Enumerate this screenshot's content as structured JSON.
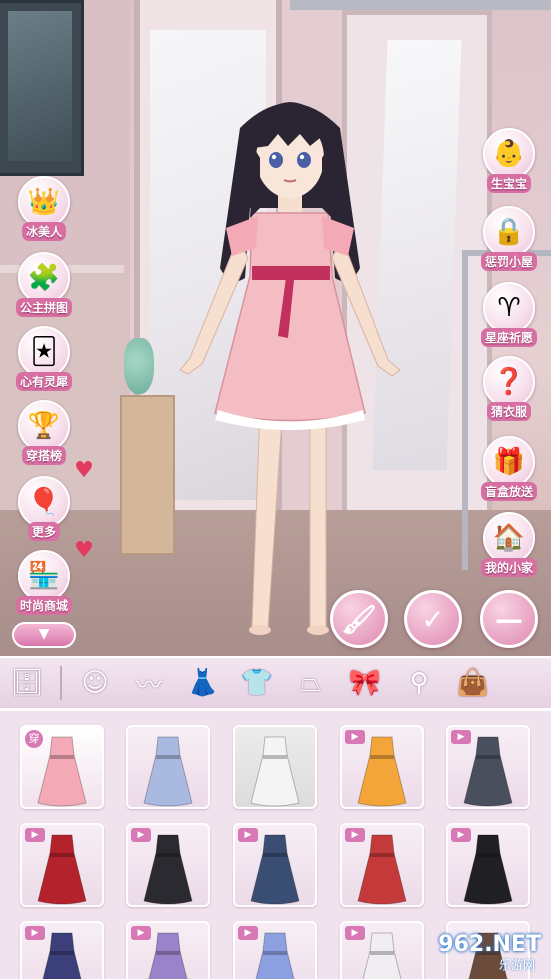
{
  "left_menu": [
    {
      "label": "冰美人",
      "icon": "crown-icon",
      "glyph": "👑"
    },
    {
      "label": "公主拼图",
      "icon": "puzzle-icon",
      "glyph": "🧩"
    },
    {
      "label": "心有灵犀",
      "icon": "cards-icon",
      "glyph": "🃏"
    },
    {
      "label": "穿搭榜",
      "icon": "trophy-crown-icon",
      "glyph": "🏆"
    },
    {
      "label": "更多",
      "icon": "balloons-icon",
      "glyph": "🎈"
    },
    {
      "label": "时尚商城",
      "icon": "shop-icon",
      "glyph": "🏪"
    }
  ],
  "right_menu": [
    {
      "label": "生宝宝",
      "icon": "baby-icon",
      "glyph": "👶"
    },
    {
      "label": "惩罚小屋",
      "icon": "cage-icon",
      "glyph": "🔒"
    },
    {
      "label": "星座祈愿",
      "icon": "zodiac-icon",
      "glyph": "♈"
    },
    {
      "label": "猜衣服",
      "icon": "question-icon",
      "glyph": "❓"
    },
    {
      "label": "盲盒放送",
      "icon": "gift-box-icon",
      "glyph": "🎁"
    },
    {
      "label": "我的小家",
      "icon": "house-icon",
      "glyph": "🏠"
    }
  ],
  "collapse_glyph": "▼",
  "actions": {
    "brush": "🖌",
    "confirm": "✓",
    "minus": "—"
  },
  "categories": [
    {
      "name": "wardrobe",
      "glyph": "🗄"
    },
    {
      "name": "face",
      "glyph": "☺"
    },
    {
      "name": "hair",
      "glyph": "〰"
    },
    {
      "name": "dress",
      "glyph": "👗",
      "active": true
    },
    {
      "name": "top",
      "glyph": "👕"
    },
    {
      "name": "skirt",
      "glyph": "⏢"
    },
    {
      "name": "bow",
      "glyph": "🎀"
    },
    {
      "name": "earrings",
      "glyph": "⚲"
    },
    {
      "name": "bag",
      "glyph": "👜"
    }
  ],
  "items_row1": [
    {
      "tag": "穿",
      "color": "#f4a9b6"
    },
    {
      "tag": "",
      "color": "#a9b9e0"
    },
    {
      "tag": "",
      "color": "#f4f4f4"
    },
    {
      "tag": "▶",
      "color": "#f3a53a"
    },
    {
      "tag": "▶",
      "color": "#4a4f5e"
    }
  ],
  "items_row2": [
    {
      "tag": "▶",
      "color": "#b4232c"
    },
    {
      "tag": "▶",
      "color": "#2a2a30"
    },
    {
      "tag": "▶",
      "color": "#3a4e74"
    },
    {
      "tag": "▶",
      "color": "#c43a3a"
    },
    {
      "tag": "▶",
      "color": "#202024"
    }
  ],
  "items_row3": [
    {
      "tag": "▶",
      "color": "#3b3f7a"
    },
    {
      "tag": "▶",
      "color": "#9b83c9"
    },
    {
      "tag": "▶",
      "color": "#8ca0e0"
    },
    {
      "tag": "▶",
      "color": "#f0eef2"
    },
    {
      "tag": "",
      "color": "#6b4b3a"
    }
  ],
  "watermark": {
    "brand": "962.NET",
    "sub": "乐游网"
  }
}
